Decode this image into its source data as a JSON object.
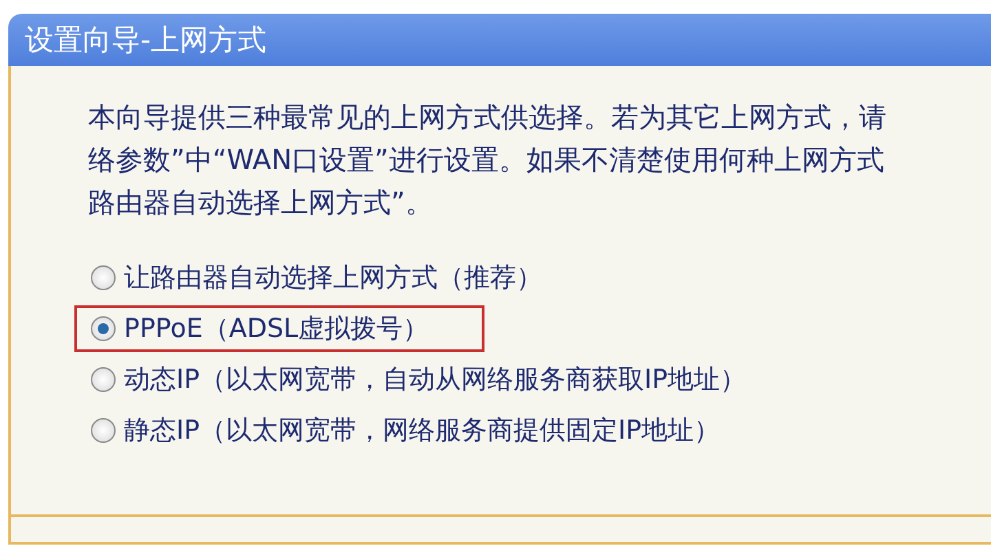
{
  "panel": {
    "title": "设置向导-上网方式"
  },
  "intro_lines": [
    "本向导提供三种最常见的上网方式供选择。若为其它上网方式，请",
    "络参数”中“WAN口设置”进行设置。如果不清楚使用何种上网方式",
    "路由器自动选择上网方式”。"
  ],
  "options": [
    {
      "label": "让路由器自动选择上网方式（推荐）",
      "selected": false
    },
    {
      "label": "PPPoE（ADSL虚拟拨号）",
      "selected": true
    },
    {
      "label": "动态IP（以太网宽带，自动从网络服务商获取IP地址）",
      "selected": false
    },
    {
      "label": "静态IP（以太网宽带，网络服务商提供固定IP地址）",
      "selected": false
    }
  ]
}
